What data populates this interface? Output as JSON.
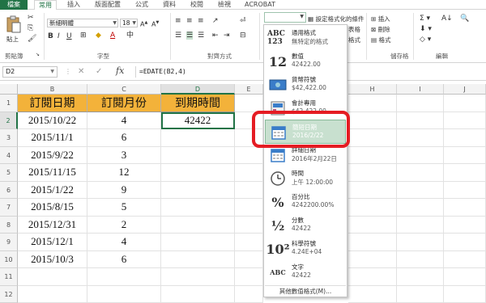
{
  "ribbon": {
    "tabs": [
      "檔案",
      "常用",
      "插入",
      "版面配置",
      "公式",
      "資料",
      "校閱",
      "檢視",
      "ACROBAT"
    ],
    "font_name": "新細明體",
    "font_size": "18",
    "paste_label": "貼上",
    "groups": {
      "clipboard": "剪貼簿",
      "font": "字型",
      "alignment": "對齊方式",
      "cells": "儲存格",
      "editing": "編輯"
    },
    "cond_format": "設定格式化的條件",
    "insert": "插入",
    "delete": "刪除",
    "format": "格式",
    "table_fmt": "表格",
    "cell_style": "格式"
  },
  "formula_bar": {
    "name_box": "D2",
    "formula": "=EDATE(B2,4)",
    "fx_label": "fx",
    "cancel_icon": "✕",
    "enter_icon": "✓"
  },
  "grid": {
    "columns": [
      "B",
      "C",
      "D",
      "E",
      "H",
      "I",
      "J"
    ],
    "rows": [
      "1",
      "2",
      "3",
      "4",
      "5",
      "6",
      "7",
      "8",
      "9",
      "10",
      "11",
      "12"
    ],
    "headers": [
      "訂閱日期",
      "訂閱月份",
      "到期時間"
    ],
    "data": [
      [
        "2015/10/22",
        "4",
        "42422"
      ],
      [
        "2015/11/1",
        "6",
        ""
      ],
      [
        "2015/9/22",
        "3",
        ""
      ],
      [
        "2015/11/15",
        "12",
        ""
      ],
      [
        "2015/1/22",
        "9",
        ""
      ],
      [
        "2015/8/15",
        "5",
        ""
      ],
      [
        "2015/12/31",
        "2",
        ""
      ],
      [
        "2015/12/1",
        "4",
        ""
      ],
      [
        "2015/10/3",
        "6",
        ""
      ]
    ]
  },
  "number_format": {
    "items": [
      {
        "icon": "ABC 123",
        "name": "通用格式",
        "sample": "無特定的格式"
      },
      {
        "icon": "12",
        "name": "數值",
        "sample": "42422.00"
      },
      {
        "icon": "currency-icon",
        "name": "貨幣符號",
        "sample": "$42,422.00"
      },
      {
        "icon": "accounting-icon",
        "name": "會計專用",
        "sample": "$42,422.00"
      },
      {
        "icon": "calendar-icon",
        "name": "簡短日期",
        "sample": "2016/2/22"
      },
      {
        "icon": "calendar-icon",
        "name": "詳細日期",
        "sample": "2016年2月22日"
      },
      {
        "icon": "clock-icon",
        "name": "時間",
        "sample": "上午 12:00:00"
      },
      {
        "icon": "%",
        "name": "百分比",
        "sample": "4242200.00%"
      },
      {
        "icon": "½",
        "name": "分數",
        "sample": "42422"
      },
      {
        "icon": "10²",
        "name": "科學符號",
        "sample": "4.24E+04"
      },
      {
        "icon": "ABC",
        "name": "文字",
        "sample": "42422"
      }
    ],
    "more": "其他數值格式(M)...",
    "highlight_color": "#89b899",
    "ring_color": "#e51c23"
  }
}
